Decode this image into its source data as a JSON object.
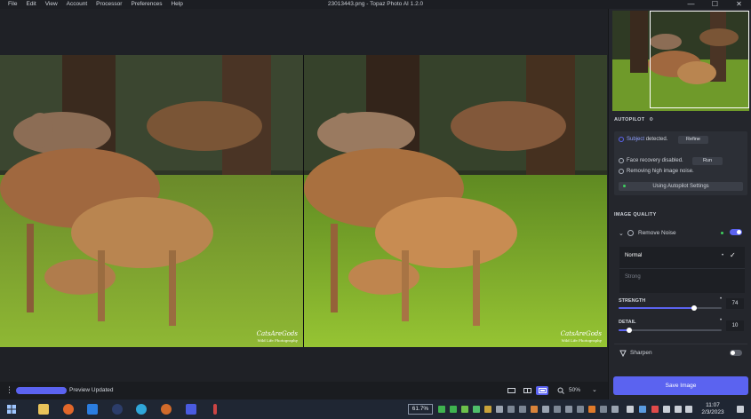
{
  "app": {
    "menu": [
      "File",
      "Edit",
      "View",
      "Account",
      "Processor",
      "Preferences",
      "Help"
    ],
    "window_title": "23013443.png - Topaz Photo AI 1.2.0",
    "window_controls": [
      "—",
      "☐",
      "✕"
    ]
  },
  "canvas": {
    "watermark_main": "CatsAreGods",
    "watermark_sub": "Wild Life Photography"
  },
  "statusbar": {
    "progress": 1.0,
    "status_text": "Preview Updated",
    "zoom_level": "50%",
    "view_modes": [
      "single-view",
      "side-by-side",
      "split-view"
    ],
    "active_view": "split-view"
  },
  "panel": {
    "autopilot": {
      "title": "AUTOPILOT",
      "subject_label": "Subject",
      "subject_status": "detected.",
      "refine_label": "Refine",
      "face_recovery_text": "Face recovery disabled.",
      "run_label": "Run",
      "noise_text": "Removing high image noise.",
      "settings_label": "Using Autopilot Settings"
    },
    "image_quality": {
      "title": "IMAGE QUALITY",
      "remove_noise": {
        "label": "Remove Noise",
        "enabled": true,
        "modes": [
          "Normal",
          "Strong"
        ],
        "selected_mode": "Normal",
        "strength_label": "STRENGTH",
        "strength_value": "74",
        "detail_label": "DETAIL",
        "detail_value": "10"
      },
      "sharpen": {
        "label": "Sharpen",
        "enabled": false
      }
    },
    "save_label": "Save Image"
  },
  "taskbar": {
    "zoom_badge": "61.7%",
    "clock_time": "11:07",
    "clock_date": "2/3/2023"
  },
  "colors": {
    "accent": "#5b63f0",
    "panel_bg": "#24262c",
    "canvas_bg": "#1f2126",
    "status_green": "#3fcf5f"
  }
}
